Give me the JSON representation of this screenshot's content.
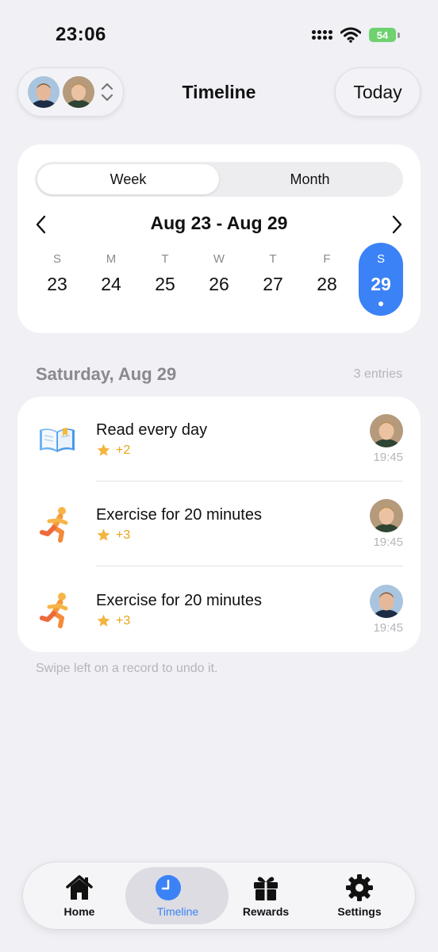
{
  "status_bar": {
    "time": "23:06",
    "battery": "54"
  },
  "header": {
    "title": "Timeline",
    "today_label": "Today"
  },
  "calendar": {
    "segments": [
      "Week",
      "Month"
    ],
    "active_segment": "Week",
    "range_label": "Aug 23 - Aug 29",
    "days": [
      {
        "letter": "S",
        "number": "23"
      },
      {
        "letter": "M",
        "number": "24"
      },
      {
        "letter": "T",
        "number": "25"
      },
      {
        "letter": "W",
        "number": "26"
      },
      {
        "letter": "T",
        "number": "27"
      },
      {
        "letter": "F",
        "number": "28"
      },
      {
        "letter": "S",
        "number": "29"
      }
    ],
    "selected_day": "29",
    "accent_color": "#3B82F6"
  },
  "section": {
    "date_label": "Saturday, Aug 29",
    "count_label": "3 entries"
  },
  "entries": [
    {
      "icon": "book-icon",
      "title": "Read every day",
      "points": "+2",
      "time": "19:45",
      "avatar": "child-2"
    },
    {
      "icon": "runner-icon",
      "title": "Exercise for 20 minutes",
      "points": "+3",
      "time": "19:45",
      "avatar": "child-2"
    },
    {
      "icon": "runner-icon",
      "title": "Exercise for 20 minutes",
      "points": "+3",
      "time": "19:45",
      "avatar": "child-1"
    }
  ],
  "hint": "Swipe left on a record to undo it.",
  "tabs": [
    {
      "label": "Home",
      "icon": "home-icon"
    },
    {
      "label": "Timeline",
      "icon": "clock-icon"
    },
    {
      "label": "Rewards",
      "icon": "gift-icon"
    },
    {
      "label": "Settings",
      "icon": "gear-icon"
    }
  ],
  "active_tab": "Timeline"
}
